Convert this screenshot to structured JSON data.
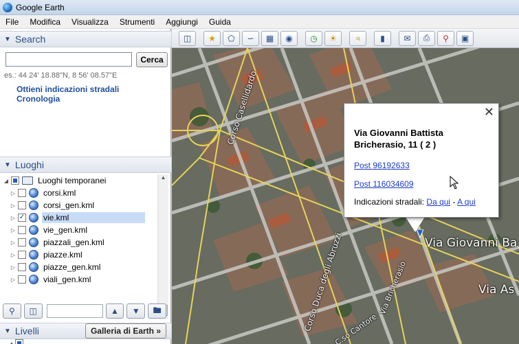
{
  "window": {
    "title": "Google Earth"
  },
  "menu": [
    "File",
    "Modifica",
    "Visualizza",
    "Strumenti",
    "Aggiungi",
    "Guida"
  ],
  "search": {
    "header": "Search",
    "input_value": "",
    "button": "Cerca",
    "example": "es.: 44 24' 18.88\"N, 8 56' 08.57\"E",
    "link_directions": "Ottieni indicazioni stradali",
    "link_history": "Cronologia"
  },
  "places": {
    "header": "Luoghi",
    "root": "Luoghi temporanei",
    "items": [
      {
        "name": "corsi.kml",
        "checked": false
      },
      {
        "name": "corsi_gen.kml",
        "checked": false
      },
      {
        "name": "vie.kml",
        "checked": true,
        "selected": true
      },
      {
        "name": "vie_gen.kml",
        "checked": false
      },
      {
        "name": "piazzali_gen.kml",
        "checked": false
      },
      {
        "name": "piazze.kml",
        "checked": false
      },
      {
        "name": "piazze_gen.kml",
        "checked": false
      },
      {
        "name": "viali_gen.kml",
        "checked": false
      }
    ]
  },
  "layers": {
    "header": "Livelli",
    "gallery_button": "Galleria di Earth »"
  },
  "map": {
    "streets": {
      "casellidardo": "Corso Casellidardo",
      "abruzzi": "Corso Duca degli Abruzzi",
      "bricherasio_small": "Via Bricherasio",
      "cantore": "C.so Cantore",
      "giovanni_ba": "Via Giovanni Ba",
      "via_as": "Via As"
    }
  },
  "balloon": {
    "title": "Via Giovanni Battista Bricherasio, 11 ( 2 )",
    "link1": "Post 96192633",
    "link2": "Post 116034609",
    "directions_label": "Indicazioni stradali:",
    "dir_from": "Da qui",
    "dir_sep": "-",
    "dir_to": "A qui"
  }
}
